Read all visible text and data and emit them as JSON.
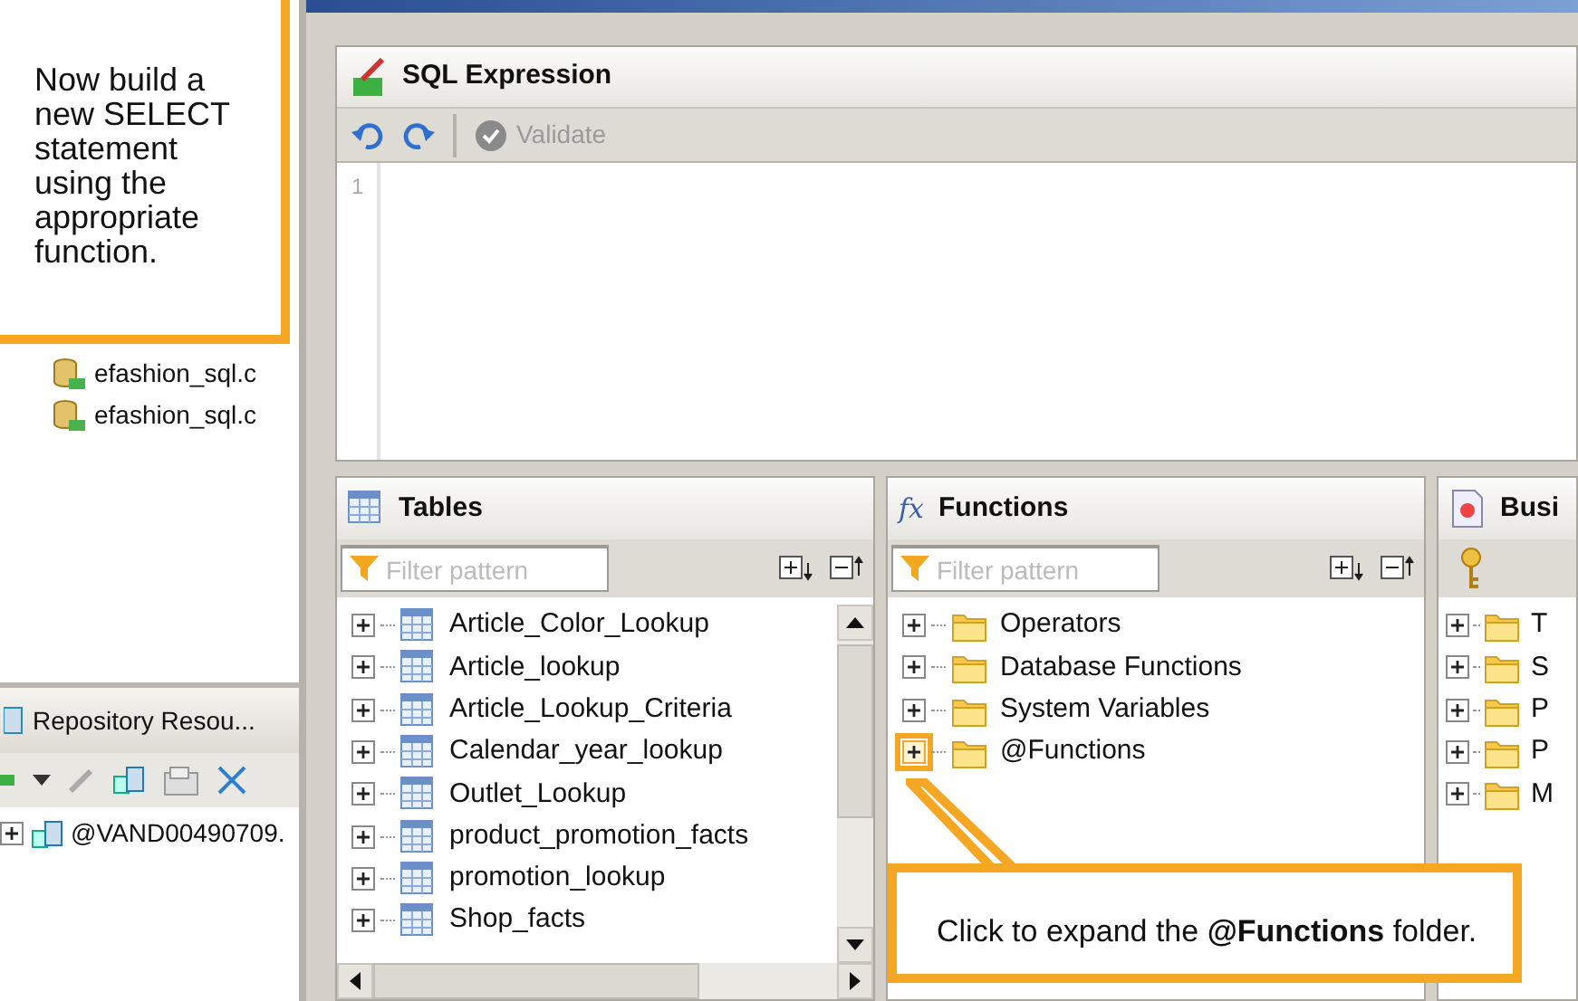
{
  "left_panel": {
    "tree_items": [
      {
        "label": "efashion_sql.c"
      },
      {
        "label": "efashion_sql.c"
      }
    ]
  },
  "repository_panel": {
    "title": "Repository Resou...",
    "tree_items": [
      {
        "label": "@VAND00490709.",
        "expanded": false
      }
    ]
  },
  "editor": {
    "header": "SQL Expression",
    "validate": {
      "label": "Validate",
      "disabled": true
    },
    "line_numbers": [
      "1"
    ]
  },
  "tables_pane": {
    "title": "Tables",
    "filter": {
      "placeholder": "Filter pattern"
    },
    "items": [
      {
        "label": "Article_Color_Lookup",
        "expanded": false
      },
      {
        "label": "Article_lookup",
        "expanded": false
      },
      {
        "label": "Article_Lookup_Criteria",
        "expanded": false
      },
      {
        "label": "Calendar_year_lookup",
        "expanded": false
      },
      {
        "label": "Outlet_Lookup",
        "expanded": false
      },
      {
        "label": "product_promotion_facts",
        "expanded": false
      },
      {
        "label": "promotion_lookup",
        "expanded": false
      },
      {
        "label": "Shop_facts",
        "expanded": false
      }
    ]
  },
  "functions_pane": {
    "title": "Functions",
    "icon_glyph": "fx",
    "filter": {
      "placeholder": "Filter pattern"
    },
    "items": [
      {
        "label": "Operators",
        "expanded": false,
        "highlighted": false
      },
      {
        "label": "Database Functions",
        "expanded": false,
        "highlighted": false
      },
      {
        "label": "System Variables",
        "expanded": false,
        "highlighted": false
      },
      {
        "label": "@Functions",
        "expanded": false,
        "highlighted": true
      }
    ]
  },
  "business_pane": {
    "title": "Busi",
    "items": [
      {
        "label": "T",
        "expanded": false
      },
      {
        "label": "S",
        "expanded": false
      },
      {
        "label": "P",
        "expanded": false
      },
      {
        "label": "P",
        "expanded": false
      },
      {
        "label": "M",
        "expanded": false
      }
    ]
  },
  "callouts": [
    {
      "text": "Now build a new SELECT statement using the appropriate function."
    },
    {
      "text": "Click to expand the **@Functions** folder."
    }
  ]
}
